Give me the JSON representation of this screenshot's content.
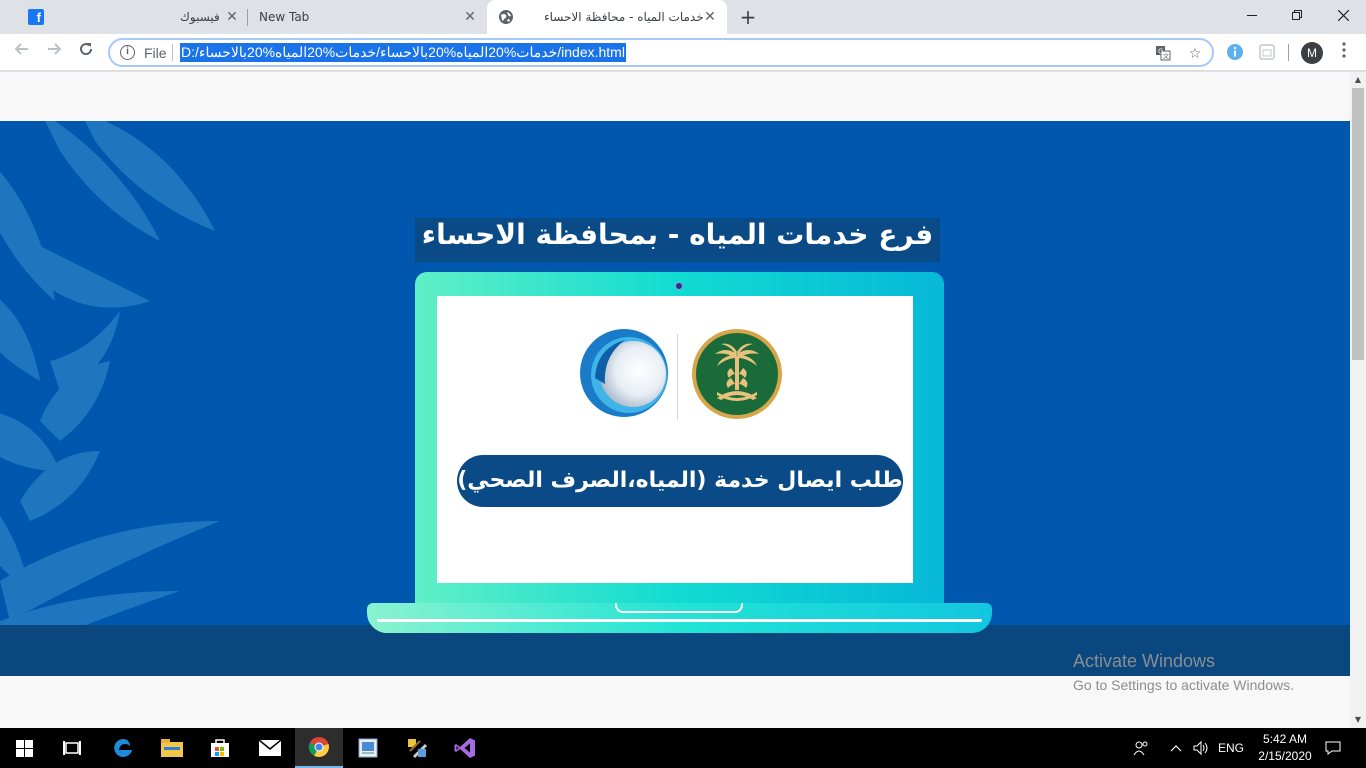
{
  "browser": {
    "tabs": [
      {
        "title": "فيسبوك",
        "icon": "facebook-icon",
        "active": false
      },
      {
        "title": "New Tab",
        "icon": "",
        "active": false
      },
      {
        "title": "خدمات المياه - محافظة الاحساء",
        "icon": "globe-icon",
        "active": true
      }
    ],
    "file_label": "File",
    "url": "D:/خدمات%20المياه%20بالاحساء/خدمات%20المياه%20بالاحساء/index.html",
    "profile_initial": "M"
  },
  "page": {
    "headline": "فرع خدمات المياه - بمحافظة الاحساء",
    "service_button": "طلب ايصال خدمة (المياه،الصرف الصحي)",
    "colors": {
      "banner": "#0157ad",
      "banner_dark": "#0a477f",
      "headline_bg": "#0a4a86",
      "laptop_teal": "#11dbd2",
      "ministry_green": "#1b6b3a",
      "ministry_gold": "#d7a64a"
    }
  },
  "watermark": {
    "title": "Activate Windows",
    "subtitle": "Go to Settings to activate Windows."
  },
  "taskbar": {
    "apps": [
      "start-icon",
      "task-view-icon",
      "edge-icon",
      "file-explorer-icon",
      "store-icon",
      "mail-icon",
      "chrome-icon",
      "photo-viewer-icon",
      "tools-icon",
      "visual-studio-icon"
    ],
    "language": "ENG",
    "time": "5:42 AM",
    "date": "2/15/2020"
  }
}
